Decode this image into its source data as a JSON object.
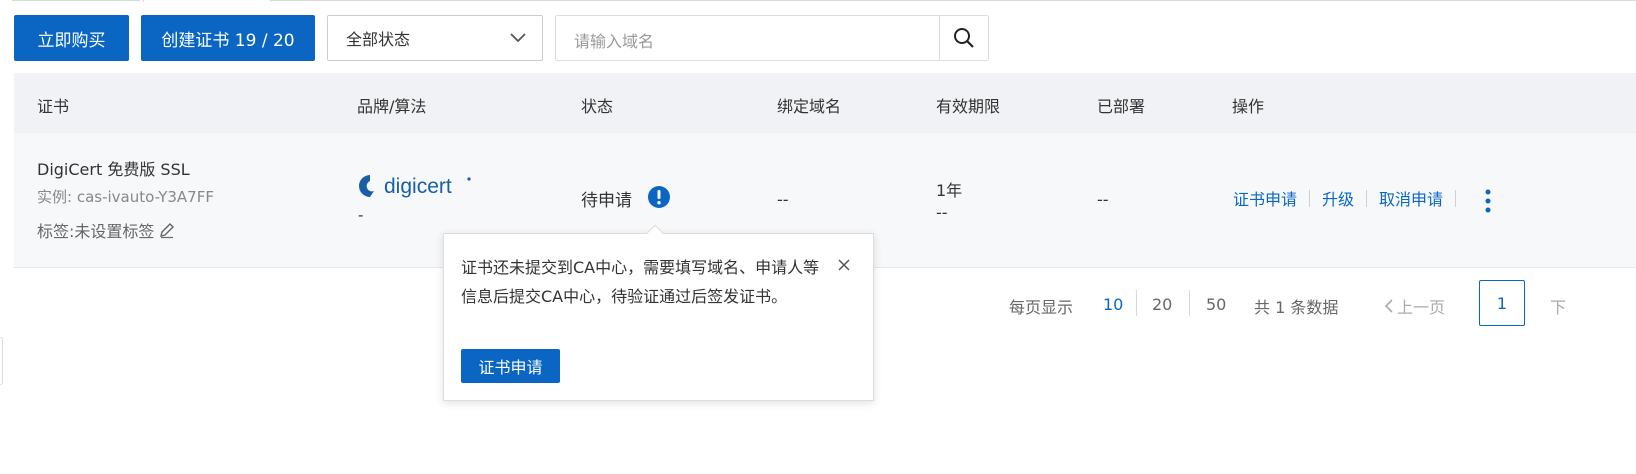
{
  "toolbar": {
    "buy_label": "立即购买",
    "create_label": "创建证书 19 / 20",
    "status_select": "全部状态",
    "search_placeholder": "请输入域名"
  },
  "table": {
    "headers": [
      "证书",
      "品牌/算法",
      "状态",
      "绑定域名",
      "有效期限",
      "已部署",
      "操作"
    ],
    "row": {
      "cert_name": "DigiCert 免费版 SSL",
      "instance": "实例: cas-ivauto-Y3A7FF",
      "tag": "标签:未设置标签",
      "brand_logo_text": "digicert",
      "algorithm": "-",
      "status": "待申请",
      "domain": "--",
      "period": "1年",
      "period_end": "--",
      "deployed": "--",
      "ops": [
        "证书申请",
        "升级",
        "取消申请"
      ]
    }
  },
  "pagination": {
    "per_page_label": "每页显示",
    "sizes": [
      "10",
      "20",
      "50"
    ],
    "total": "共 1 条数据",
    "prev": "上一页",
    "current": "1",
    "next": "下"
  },
  "popover": {
    "message": "证书还未提交到CA中心，需要填写域名、申请人等信息后提交CA中心，待验证通过后签发证书。",
    "button": "证书申请"
  },
  "colors": {
    "primary": "#0a66c2",
    "header_bg": "#f0f2f5",
    "row_bg": "#f7f8fa"
  }
}
